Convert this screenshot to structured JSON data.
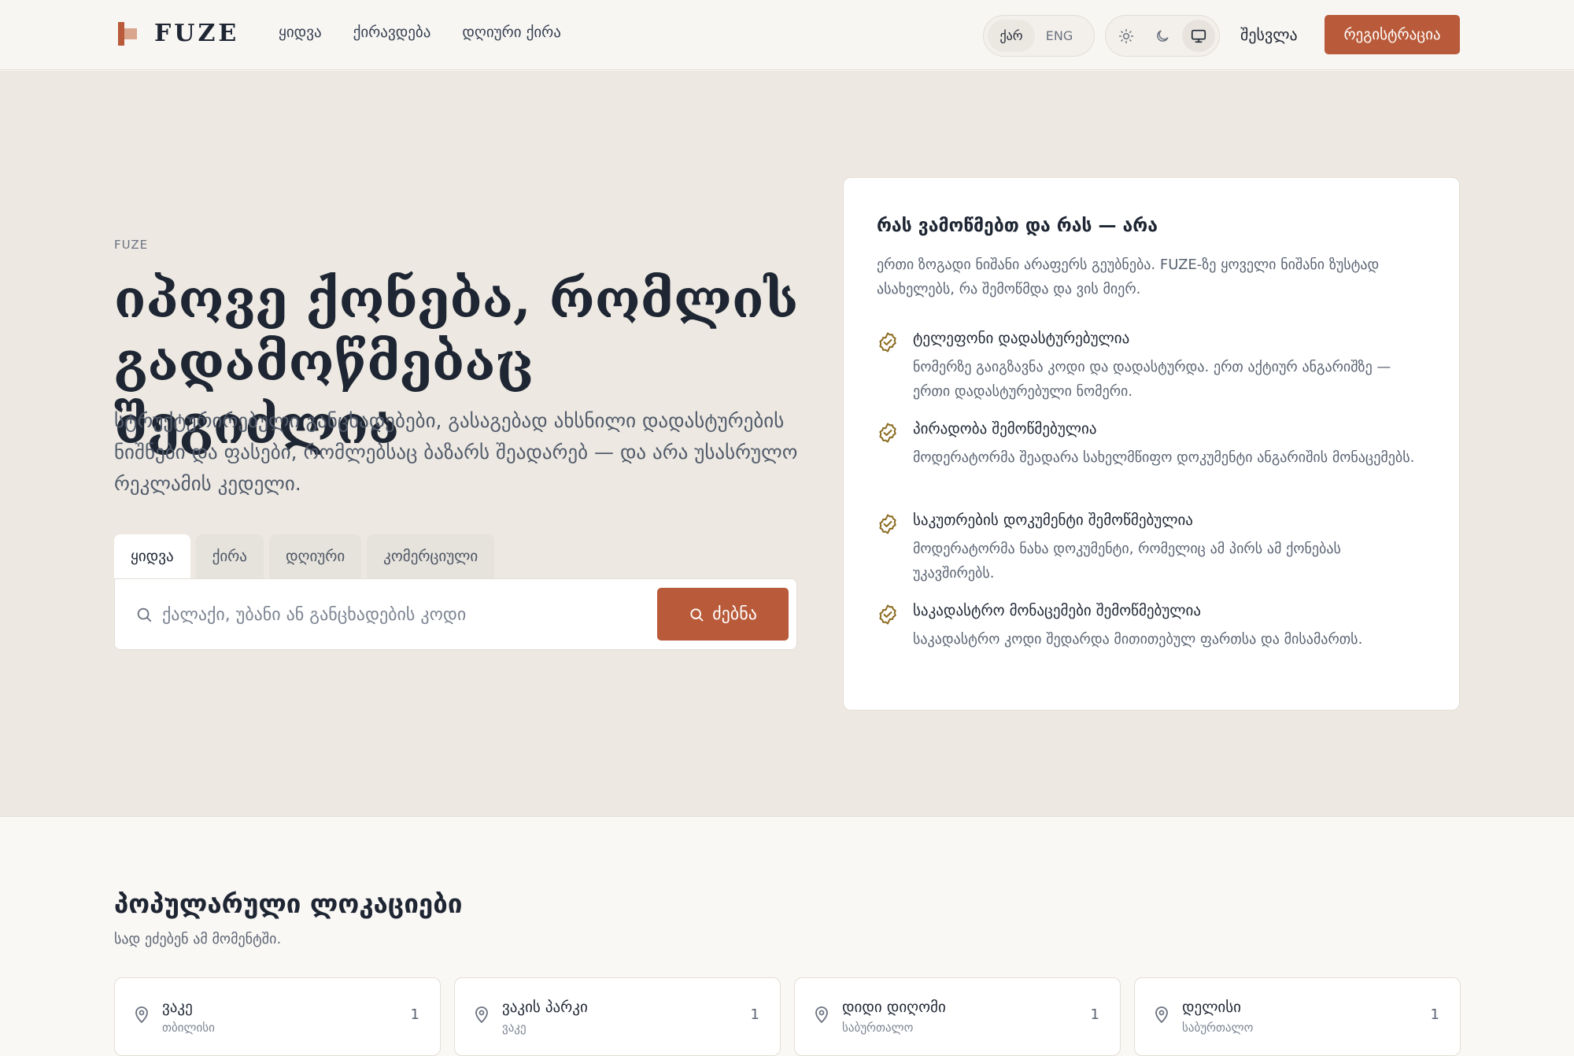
{
  "brand": {
    "name": "FUZE"
  },
  "nav": [
    {
      "label": "ყიდვა"
    },
    {
      "label": "ქირავდება"
    },
    {
      "label": "დღიური ქირა"
    }
  ],
  "language": {
    "options": [
      "ქარ",
      "ENG"
    ],
    "active": "ქარ"
  },
  "theme": {
    "options": [
      "sun-icon",
      "moon-icon",
      "monitor-icon"
    ],
    "active": "monitor-icon"
  },
  "auth": {
    "login": "შესვლა",
    "register": "რეგისტრაცია"
  },
  "colors": {
    "accent": "#b95b3a",
    "check": "#8b6a1f"
  },
  "hero": {
    "eyebrow": "FUZE",
    "headline": "იპოვე ქონება, რომლის გადამოწმებაც შეგიძლია",
    "subtext": "სტრუქტურირებული განცხადებები, გასაგებად ახსნილი დადასტურების ნიშნები და ფასები, რომლებსაც ბაზარს შეადარებ — და არა უსასრულო რეკლამის კედელი.",
    "tabs": [
      "ყიდვა",
      "ქირა",
      "დღიური",
      "კომერციული"
    ],
    "active_tab": "ყიდვა",
    "search": {
      "placeholder": "ქალაქი, უბანი ან განცხადების კოდი",
      "value": "",
      "button": "ძებნა"
    }
  },
  "verify_card": {
    "title": "რას ვამოწმებთ და რას — არა",
    "intro": "ერთი ზოგადი ნიშანი არაფერს გეუბნება. FUZE-ზე ყოველი ნიშანი ზუსტად ასახელებს, რა შემოწმდა და ვის მიერ.",
    "items": [
      {
        "title": "ტელეფონი დადასტურებულია",
        "desc": "ნომერზე გაიგზავნა კოდი და დადასტურდა. ერთ აქტიურ ანგარიშზე — ერთი დადასტურებული ნომერი."
      },
      {
        "title": "პირადობა შემოწმებულია",
        "desc": "მოდერატორმა შეადარა სახელმწიფო დოკუმენტი ანგარიშის მონაცემებს."
      },
      {
        "title": "საკუთრების დოკუმენტი შემოწმებულია",
        "desc": "მოდერატორმა ნახა დოკუმენტი, რომელიც ამ პირს ამ ქონებას უკავშირებს."
      },
      {
        "title": "საკადასტრო მონაცემები შემოწმებულია",
        "desc": "საკადასტრო კოდი შედარდა მითითებულ ფართსა და მისამართს."
      }
    ]
  },
  "popular": {
    "title": "პოპულარული ლოკაციები",
    "subtitle": "სად ეძებენ ამ მომენტში.",
    "locations": [
      {
        "name": "ვაკე",
        "region": "თბილისი",
        "count": "1"
      },
      {
        "name": "ვაკის პარკი",
        "region": "ვაკე",
        "count": "1"
      },
      {
        "name": "დიდი დიღომი",
        "region": "საბურთალო",
        "count": "1"
      },
      {
        "name": "დელისი",
        "region": "საბურთალო",
        "count": "1"
      }
    ]
  }
}
